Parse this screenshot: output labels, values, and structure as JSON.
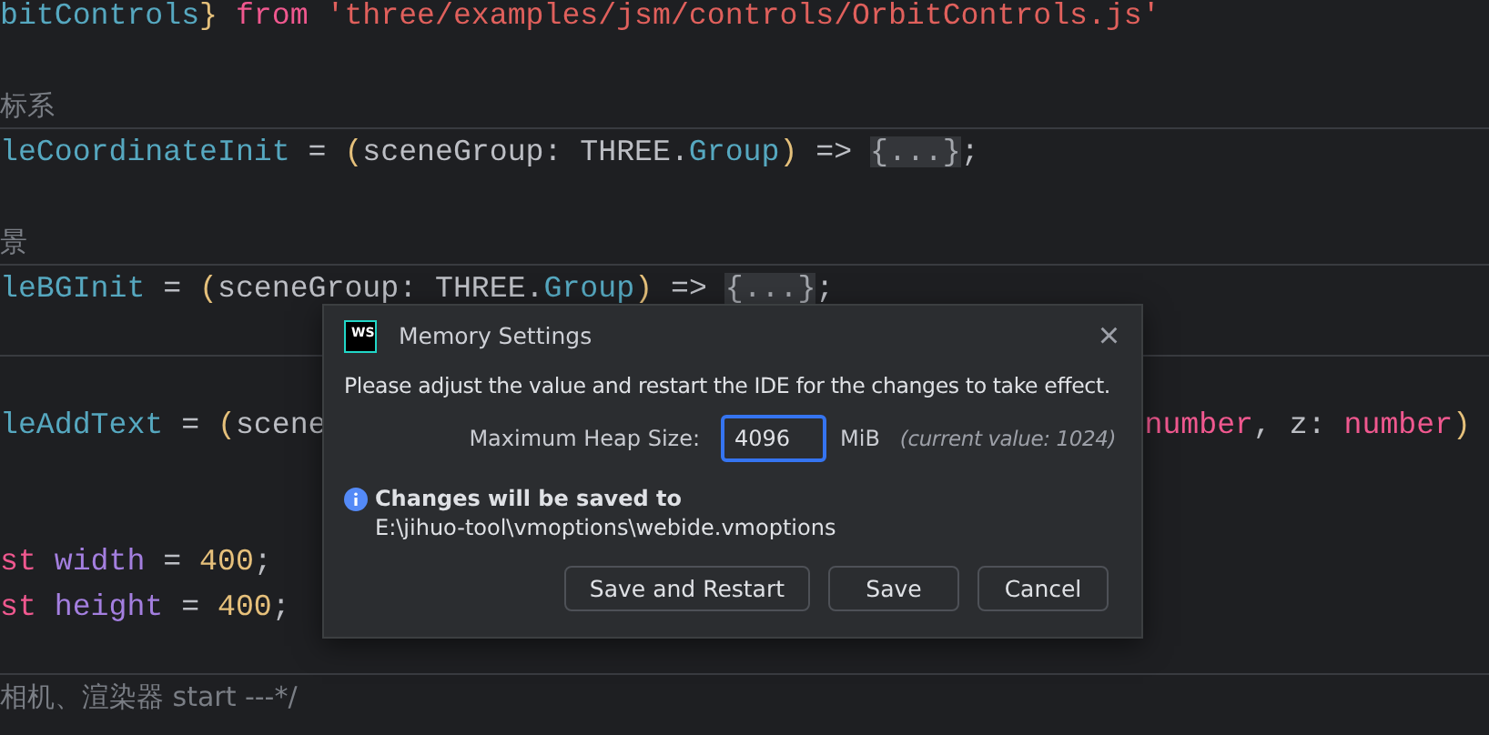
{
  "editor": {
    "lines": [
      {
        "tokens": [
          {
            "kind": "ident",
            "text": "bitControls"
          },
          {
            "kind": "paren",
            "text": "}"
          },
          {
            "kind": "keyword",
            "text": " from"
          },
          {
            "kind": "string",
            "text": " 'three/examples/jsm/controls/OrbitControls.js'"
          }
        ]
      },
      {
        "separator": false
      },
      {
        "separator": false,
        "tokens": [
          {
            "kind": "comment",
            "text": "标系"
          }
        ]
      },
      {
        "separator": true,
        "tokens": [
          {
            "kind": "ident",
            "text": "leCoordinateInit"
          },
          {
            "kind": "plain",
            "text": " = "
          },
          {
            "kind": "paren",
            "text": "("
          },
          {
            "kind": "plain",
            "text": "sceneGroup: THREE."
          },
          {
            "kind": "ident",
            "text": "Group"
          },
          {
            "kind": "paren",
            "text": ")"
          },
          {
            "kind": "plain",
            "text": " => "
          },
          {
            "kind": "fold",
            "text": "{...}"
          },
          {
            "kind": "plain",
            "text": ";"
          }
        ]
      },
      {
        "separator": false
      },
      {
        "separator": false,
        "tokens": [
          {
            "kind": "comment",
            "text": "景"
          }
        ]
      },
      {
        "separator": true,
        "tokens": [
          {
            "kind": "ident",
            "text": "leBGInit"
          },
          {
            "kind": "plain",
            "text": " = "
          },
          {
            "kind": "paren",
            "text": "("
          },
          {
            "kind": "plain",
            "text": "sceneGroup: THREE."
          },
          {
            "kind": "ident",
            "text": "Group"
          },
          {
            "kind": "paren",
            "text": ")"
          },
          {
            "kind": "plain",
            "text": " => "
          },
          {
            "kind": "fold",
            "text": "{...}"
          },
          {
            "kind": "plain",
            "text": ";"
          }
        ]
      },
      {
        "separator": false
      },
      {
        "separator": true
      },
      {
        "separator": false,
        "tokens": [
          {
            "kind": "ident",
            "text": "leAddText"
          },
          {
            "kind": "plain",
            "text": " = "
          },
          {
            "kind": "paren",
            "text": "("
          },
          {
            "kind": "plain",
            "text": "scene"
          }
        ],
        "tail": [
          {
            "kind": "keyword",
            "text": "number"
          },
          {
            "kind": "plain",
            "text": ", z: "
          },
          {
            "kind": "keyword",
            "text": "number"
          },
          {
            "kind": "paren",
            "text": ")"
          }
        ]
      },
      {
        "separator": false
      },
      {
        "separator": false
      },
      {
        "separator": false,
        "tokens": [
          {
            "kind": "keyword",
            "text": "st"
          },
          {
            "kind": "property",
            "text": " width"
          },
          {
            "kind": "plain",
            "text": " = "
          },
          {
            "kind": "number",
            "text": "400"
          },
          {
            "kind": "plain",
            "text": ";"
          }
        ]
      },
      {
        "separator": false,
        "tokens": [
          {
            "kind": "keyword",
            "text": "st"
          },
          {
            "kind": "property",
            "text": " height"
          },
          {
            "kind": "plain",
            "text": " = "
          },
          {
            "kind": "number",
            "text": "400"
          },
          {
            "kind": "plain",
            "text": ";"
          }
        ]
      },
      {
        "separator": false
      },
      {
        "separator": true,
        "tokens": [
          {
            "kind": "comment",
            "text": "相机、渲染器 start ---*/"
          }
        ]
      }
    ]
  },
  "dialog": {
    "logo": "WS",
    "title": "Memory Settings",
    "close": "×",
    "message": "Please adjust the value and restart the IDE for the changes to take effect.",
    "heap": {
      "label": "Maximum Heap Size:",
      "value": "4096",
      "focused": true,
      "unit": "MiB",
      "current": "(current value: 1024)"
    },
    "info": {
      "title": "Changes will be saved to",
      "path": "E:\\jihuo-tool\\vmoptions\\webide.vmoptions"
    },
    "buttons": [
      "Save and Restart",
      "Save",
      "Cancel"
    ]
  }
}
